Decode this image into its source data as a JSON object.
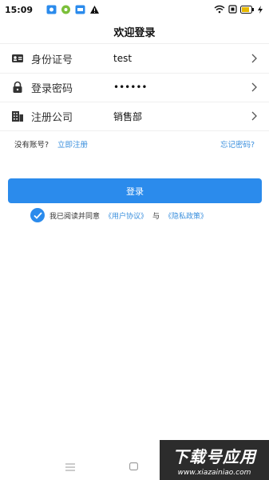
{
  "status_bar": {
    "time": "15:09"
  },
  "header": {
    "title": "欢迎登录"
  },
  "form": {
    "rows": [
      {
        "icon": "id-card-icon",
        "label": "身份证号",
        "value": "test"
      },
      {
        "icon": "lock-icon",
        "label": "登录密码",
        "value": "••••••"
      },
      {
        "icon": "building-icon",
        "label": "注册公司",
        "value": "销售部"
      }
    ]
  },
  "links": {
    "no_account": "没有账号?",
    "register": "立即注册",
    "forgot": "忘记密码?"
  },
  "login_button": {
    "label": "登录"
  },
  "agreement": {
    "checked": true,
    "text": "我已阅读并同意",
    "user_agreement": "《用户协议》",
    "and": "与",
    "privacy_policy": "《隐私政策》"
  },
  "watermark": {
    "main": "下载号应用",
    "sub": "www.xiazainiao.com"
  },
  "colors": {
    "accent": "#2b8bec",
    "link": "#3a8fdd"
  }
}
